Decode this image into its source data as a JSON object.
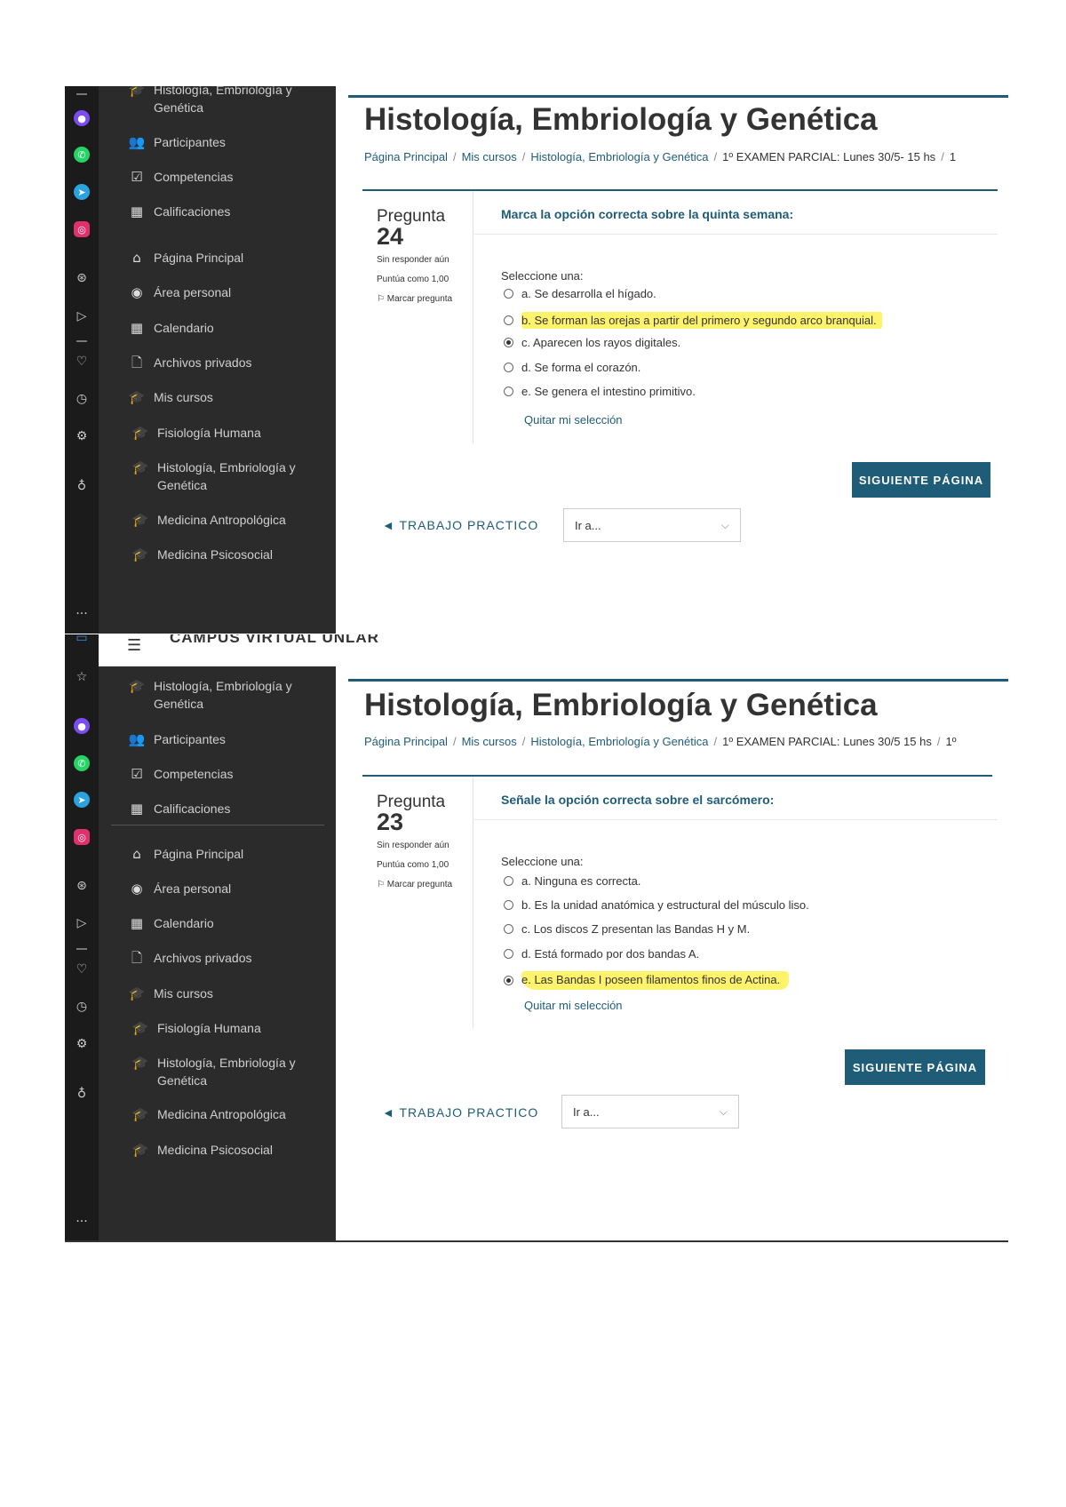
{
  "nav_items": {
    "course_top": "Histología, Embriología y Genética",
    "participants": "Participantes",
    "competencies": "Competencias",
    "grades": "Calificaciones",
    "home": "Página Principal",
    "dashboard": "Área personal",
    "calendar": "Calendario",
    "private_files": "Archivos privados",
    "my_courses": "Mis cursos",
    "course_fisiologia": "Fisiología Humana",
    "course_histologia": "Histología, Embriología y Genética",
    "course_antropologica": "Medicina Antropológica",
    "course_psicosocial": "Medicina Psicosocial"
  },
  "icons": {
    "mortarboard": "🎓",
    "participants": "👥",
    "competencies": "☑",
    "grades": "▦",
    "home": "⌂",
    "dashboard": "◉",
    "calendar": "▦",
    "file": "🗋",
    "more": "···"
  },
  "colors": {
    "accent": "#1f5c78",
    "highlight": "#fff36b",
    "sidebar_bg": "#2b2b2b"
  },
  "shot1": {
    "course_title": "Histología, Embriología y Genética",
    "breadcrumb": [
      "Página Principal",
      "Mis cursos",
      "Histología, Embriología y Genética",
      "1º EXAMEN PARCIAL: Lunes 30/5- 15 hs",
      "1"
    ],
    "question_label": "Pregunta",
    "question_number": "24",
    "status": "Sin responder aún",
    "points": "Puntúa como 1,00",
    "flag": "Marcar pregunta",
    "question_text": "Marca la opción correcta sobre la quinta semana:",
    "select_label": "Seleccione una:",
    "options": [
      "a. Se desarrolla el hígado.",
      "b. Se forman las orejas a partir del primero y segundo arco branquial.",
      "c. Aparecen los rayos digitales.",
      "d. Se forma el corazón.",
      "e. Se genera el intestino primitivo."
    ],
    "clear_choice": "Quitar mi selección",
    "next_button": "SIGUIENTE PÁGINA",
    "prev_activity": "◄ TRABAJO PRACTICO",
    "jump_placeholder": "Ir a..."
  },
  "shot2": {
    "site_name": "CAMPUS VIRTUAL UNLAR",
    "course_title": "Histología, Embriología y Genética",
    "breadcrumb": [
      "Página Principal",
      "Mis cursos",
      "Histología, Embriología y Genética",
      "1º EXAMEN PARCIAL: Lunes 30/5 15 hs",
      "1º"
    ],
    "question_label": "Pregunta",
    "question_number": "23",
    "status": "Sin responder aún",
    "points": "Puntúa como 1,00",
    "flag": "Marcar pregunta",
    "question_text": "Señale la opción correcta sobre el sarcómero:",
    "select_label": "Seleccione una:",
    "options": [
      "a. Ninguna es correcta.",
      "b. Es la unidad anatómica y estructural del músculo liso.",
      "c. Los discos Z presentan las Bandas H y M.",
      "d. Está formado por dos bandas A.",
      "e. Las Bandas I poseen filamentos finos de Actina."
    ],
    "clear_choice": "Quitar mi selección",
    "next_button": "SIGUIENTE PÁGINA",
    "prev_activity": "◄ TRABAJO PRACTICO",
    "jump_placeholder": "Ir a..."
  }
}
